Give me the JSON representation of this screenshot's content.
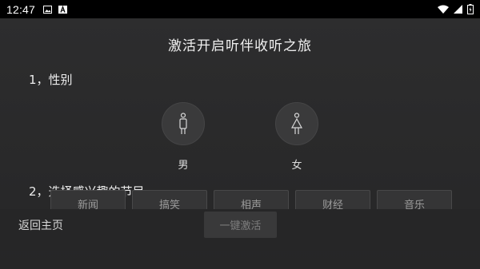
{
  "status_bar": {
    "time": "12:47",
    "icons": [
      "image-icon",
      "a-badge-icon",
      "wifi-icon",
      "signal-icon",
      "battery-icon"
    ]
  },
  "page": {
    "title": "激活开启听伴收听之旅",
    "section1_label": "1，性别",
    "section2_label": "2，选择感兴趣的节目"
  },
  "gender": {
    "options": [
      {
        "label": "男",
        "icon": "male-icon"
      },
      {
        "label": "女",
        "icon": "female-icon"
      }
    ]
  },
  "programs": [
    {
      "label": "新闻"
    },
    {
      "label": "搞笑"
    },
    {
      "label": "相声"
    },
    {
      "label": "财经"
    },
    {
      "label": "音乐"
    }
  ],
  "footer": {
    "back_label": "返回主页",
    "activate_label": "一键激活"
  },
  "colors": {
    "background": "#2a2a2b",
    "status_bar": "#000000",
    "button_bg": "#353536",
    "disabled_text": "#7e7e7e"
  }
}
